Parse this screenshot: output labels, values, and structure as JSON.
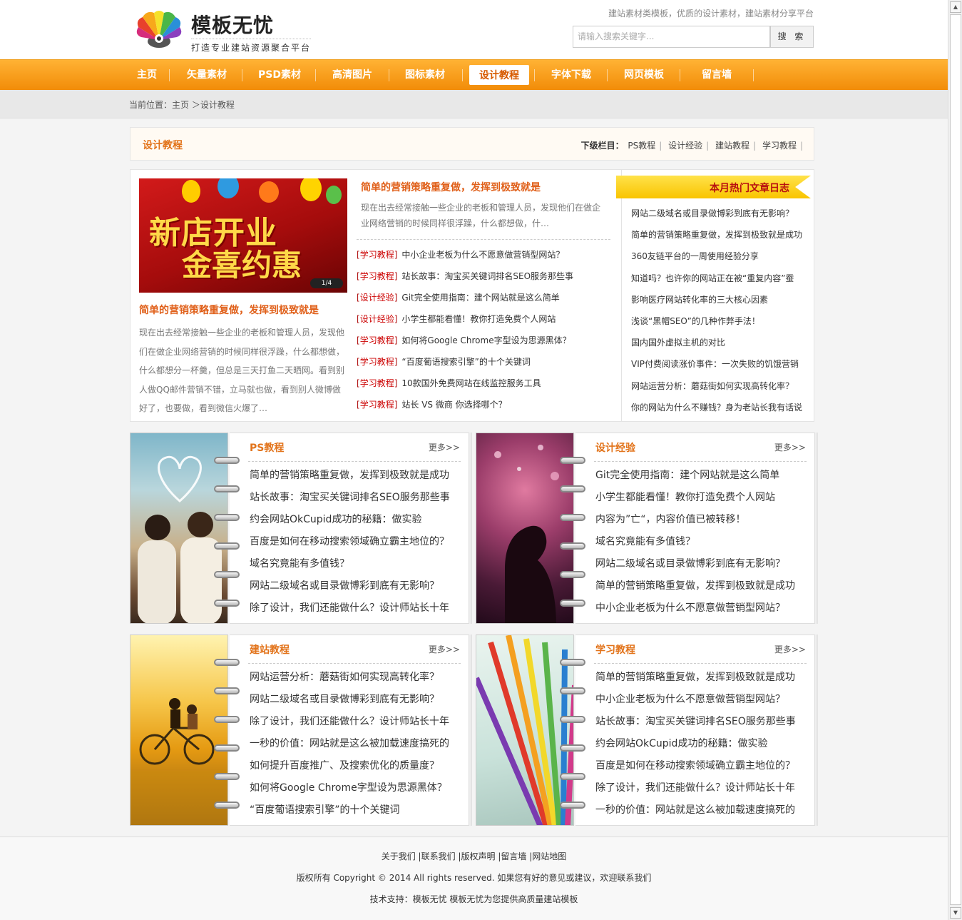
{
  "header": {
    "logo_title": "模板无忧",
    "logo_sub": "打造专业建站资源聚合平台",
    "slogan": "建站素材类模板，优质的设计素材，建站素材分享平台",
    "search_placeholder": "请输入搜索关键字...",
    "search_label": "搜 索"
  },
  "nav": {
    "items": [
      "主页",
      "矢量素材",
      "PSD素材",
      "高清图片",
      "图标素材",
      "设计教程",
      "字体下载",
      "网页模板",
      "留言墙"
    ],
    "active": "设计教程"
  },
  "breadcrumb": "当前位置：主页 ＞设计教程",
  "category": {
    "title": "设计教程",
    "sub_label": "下级栏目：",
    "subs": [
      "PS教程",
      "设计经验",
      "建站教程",
      "学习教程"
    ]
  },
  "featured": {
    "slide_text1": "新店开业",
    "slide_text2": "金喜约惠",
    "slide_pager": "1/4",
    "left_title": "简单的营销策略重复做，发挥到极致就是",
    "left_desc": "现在出去经常接触一些企业的老板和管理人员，发现他们在做企业网络营销的时候同样很浮躁，什么都想做，什么都想分一杯羹，但总是三天打鱼二天晒网。看到别人做QQ邮件营销不错，立马就也做，看到别人微博做好了，也要做，看到微信火爆了…",
    "mid_title": "简单的营销策略重复做，发挥到极致就是",
    "mid_desc": "现在出去经常接触一些企业的老板和管理人员，发现他们在做企业网络营销的时候同样很浮躁，什么都想做，什…",
    "list": [
      {
        "tag": "学习教程",
        "text": "中小企业老板为什么不愿意做营销型网站？"
      },
      {
        "tag": "学习教程",
        "text": "站长故事：淘宝买关键词排名SEO服务那些事"
      },
      {
        "tag": "设计经验",
        "text": "Git完全使用指南：建个网站就是这么简单"
      },
      {
        "tag": "设计经验",
        "text": "小学生都能看懂！教你打造免费个人网站"
      },
      {
        "tag": "学习教程",
        "text": "如何将Google Chrome字型设为思源黑体？"
      },
      {
        "tag": "学习教程",
        "text": "“百度葡语搜索引擎”的十个关键词"
      },
      {
        "tag": "学习教程",
        "text": "10款国外免费网站在线监控服务工具"
      },
      {
        "tag": "学习教程",
        "text": "站长 VS 微商  你选择哪个？"
      }
    ]
  },
  "hot": {
    "title": "本月热门文章日志",
    "items": [
      "网站二级域名或目录做博彩到底有无影响？",
      "简单的营销策略重复做，发挥到极致就是成功",
      "360友链平台的一周使用经验分享",
      "知道吗？也许你的网站正在被“重复内容”蚕",
      "影响医疗网站转化率的三大核心因素",
      "浅谈“黑帽SEO”的几种作弊手法！",
      "国内国外虚拟主机的对比",
      "VIP付费阅读涨价事件：一次失败的饥饿营销",
      "网站运营分析：蘑菇街如何实现高转化率？",
      "你的网站为什么不赚钱？身为老站长我有话说"
    ]
  },
  "panels": {
    "ps": {
      "title": "PS教程",
      "more": "更多>>",
      "items": [
        "简单的营销策略重复做，发挥到极致就是成功",
        "站长故事：淘宝买关键词排名SEO服务那些事",
        "约会网站OkCupid成功的秘籍：做实验",
        "百度是如何在移动搜索领域确立霸主地位的？",
        "域名究竟能有多值钱？",
        "网站二级域名或目录做博彩到底有无影响？",
        "除了设计，我们还能做什么？设计师站长十年"
      ]
    },
    "design": {
      "title": "设计经验",
      "more": "更多>>",
      "items": [
        "Git完全使用指南：建个网站就是这么简单",
        "小学生都能看懂！教你打造免费个人网站",
        "内容为”亡“，内容价值已被转移！",
        "域名究竟能有多值钱？",
        "网站二级域名或目录做博彩到底有无影响？",
        "简单的营销策略重复做，发挥到极致就是成功",
        "中小企业老板为什么不愿意做营销型网站？"
      ]
    },
    "build": {
      "title": "建站教程",
      "more": "更多>>",
      "items": [
        "网站运营分析：蘑菇街如何实现高转化率？",
        "网站二级域名或目录做博彩到底有无影响？",
        "除了设计，我们还能做什么？设计师站长十年",
        "一秒的价值：网站就是这么被加载速度搞死的",
        "如何提升百度推广、及搜索优化的质量度？",
        "如何将Google Chrome字型设为思源黑体？",
        "“百度葡语搜索引擎”的十个关键词"
      ]
    },
    "learn": {
      "title": "学习教程",
      "more": "更多>>",
      "items": [
        "简单的营销策略重复做，发挥到极致就是成功",
        "中小企业老板为什么不愿意做营销型网站？",
        "站长故事：淘宝买关键词排名SEO服务那些事",
        "约会网站OkCupid成功的秘籍：做实验",
        "百度是如何在移动搜索领域确立霸主地位的？",
        "除了设计，我们还能做什么？设计师站长十年",
        "一秒的价值：网站就是这么被加载速度搞死的"
      ]
    }
  },
  "footer": {
    "links": [
      "关于我们",
      "联系我们",
      "版权声明",
      "留言墙",
      "网站地图"
    ],
    "copyright": "版权所有  Copyright © 2014 All rights reserved. 如果您有好的意见或建议，欢迎联系我们",
    "support": "技术支持：模板无忧  模板无忧为您提供高质量建站模板"
  },
  "colors": {
    "accent_orange": "#f28c08",
    "title_orange": "#e2731a",
    "tag_red": "#c00000"
  }
}
